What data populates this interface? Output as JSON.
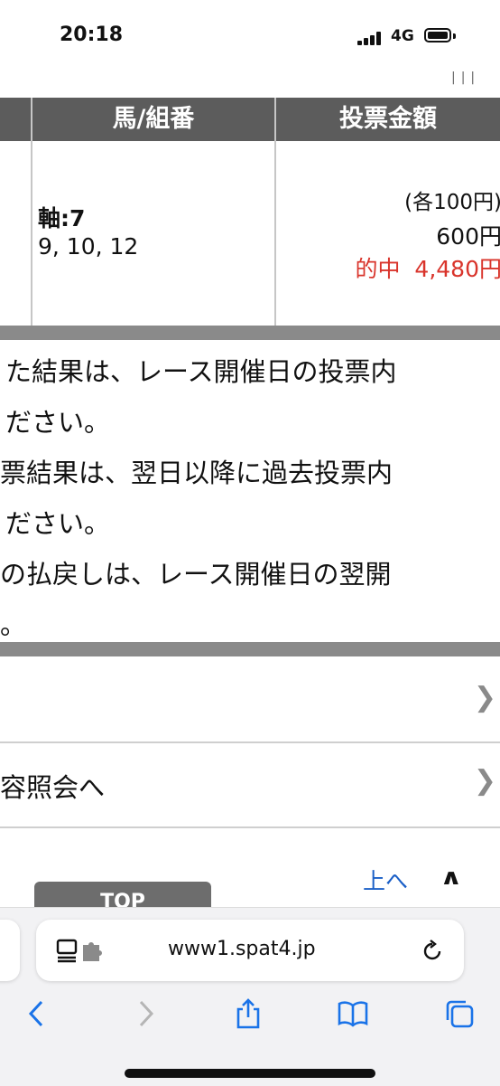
{
  "status_bar": {
    "time": "20:18",
    "network": "4G"
  },
  "top_mark": "|||",
  "table": {
    "headers": [
      "馬/組番",
      "投票金額"
    ],
    "row": {
      "axis_prefix": "軸:",
      "axis_value": "7",
      "horses": "9, 10, 12",
      "unit_amount": "(各100円)",
      "total_amount": "600円",
      "hit_label": "的中",
      "hit_amount": "4,480円"
    }
  },
  "notes": [
    "た結果は、レース開催日の投票内",
    "ださい。",
    "票結果は、翌日以降に過去投票内",
    "ださい。",
    "の払戻しは、レース開催日の翌開",
    "。"
  ],
  "links": [
    {
      "label": ""
    },
    {
      "label": "容照会へ"
    }
  ],
  "page_nav": {
    "up_label": "上へ",
    "top_label": "TOP"
  },
  "browser": {
    "url": "www1.spat4.jp"
  },
  "icons": {
    "chevron": "chevron-right-icon",
    "back": "back-icon",
    "forward": "forward-icon",
    "share": "share-icon",
    "bookmarks": "bookmarks-icon",
    "tabs": "tabs-icon"
  },
  "colors": {
    "header_bg": "#5c5c5c",
    "hit_red": "#d9342b",
    "link_blue": "#1a5fc7",
    "ios_blue": "#1a73e8"
  }
}
